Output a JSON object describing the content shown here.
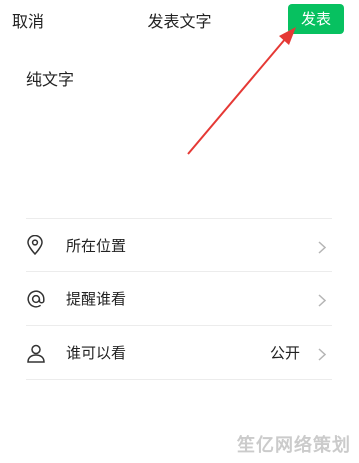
{
  "header": {
    "cancel_label": "取消",
    "title": "发表文字",
    "publish_label": "发表"
  },
  "compose": {
    "text": "纯文字"
  },
  "options": [
    {
      "label": "所在位置",
      "value": "",
      "icon": "location-pin-icon"
    },
    {
      "label": "提醒谁看",
      "value": "",
      "icon": "at-sign-icon"
    },
    {
      "label": "谁可以看",
      "value": "公开",
      "icon": "person-icon"
    }
  ],
  "watermark": "笙亿网络策划",
  "colors": {
    "accent": "#07c160",
    "annotation": "#e53935"
  }
}
